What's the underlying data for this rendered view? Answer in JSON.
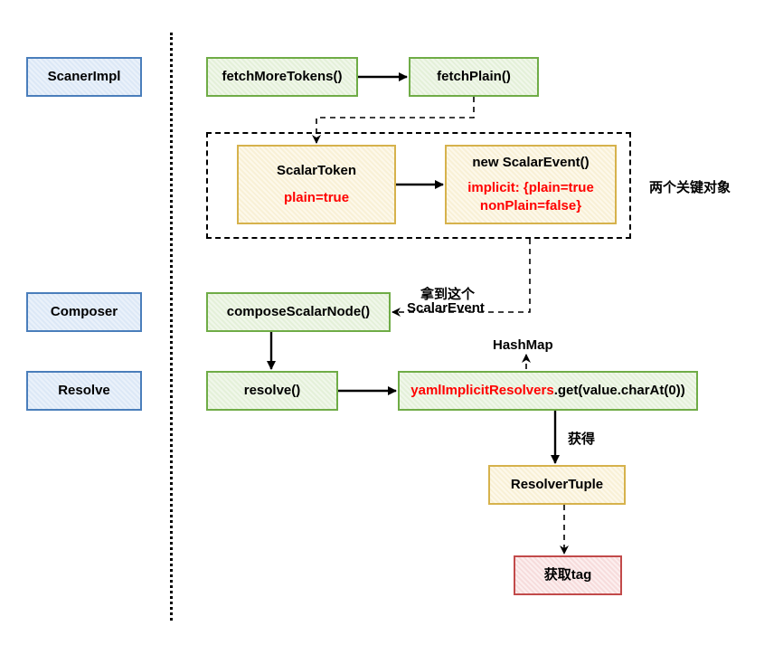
{
  "left": {
    "scanerImpl": "ScanerImpl",
    "composer": "Composer",
    "resolve": "Resolve"
  },
  "row1": {
    "fetchMoreTokens": "fetchMoreTokens()",
    "fetchPlain": "fetchPlain()"
  },
  "group": {
    "annotation": "两个关键对象",
    "scalarToken": {
      "title": "ScalarToken",
      "detail": "plain=true"
    },
    "scalarEvent": {
      "title": "new ScalarEvent()",
      "detail1": "implicit: {plain=true",
      "detail2": "nonPlain=false}"
    }
  },
  "compose": {
    "node": "composeScalarNode()",
    "edgeLabel1": "拿到这个",
    "edgeLabel2": "ScalarEvent"
  },
  "resolveRow": {
    "resolve": "resolve()",
    "hashmapLabel": "HashMap",
    "resolversPrefix": "yamlImplicitResolvers",
    "resolversSuffix": ".get(value.charAt(0))"
  },
  "tail": {
    "gainLabel": "获得",
    "resolverTuple": "ResolverTuple",
    "getTag": "获取tag"
  }
}
